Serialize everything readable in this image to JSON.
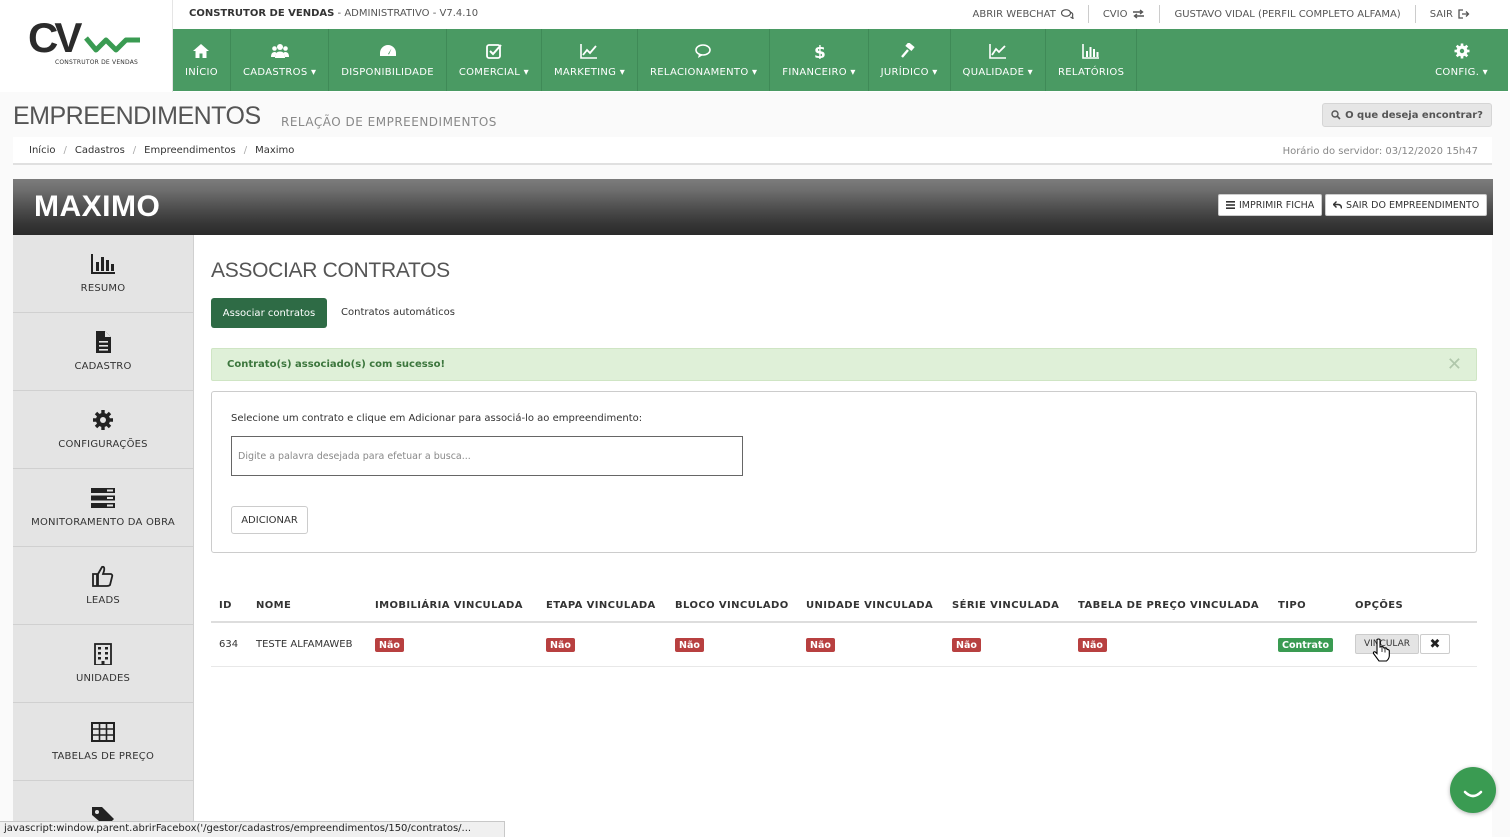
{
  "brand": {
    "logo_text": "CV",
    "tagline": "CONSTRUTOR DE VENDAS"
  },
  "system": {
    "name": "CONSTRUTOR DE VENDAS",
    "rest": " - ADMINISTRATIVO - V7.4.10"
  },
  "toplinks": [
    "ABRIR WEBCHAT",
    "CVIO",
    "GUSTAVO VIDAL (PERFIL COMPLETO ALFAMA)",
    "SAIR"
  ],
  "nav": [
    {
      "label": "INÍCIO",
      "icon": "home-icon"
    },
    {
      "label": "CADASTROS ▾",
      "icon": "users-icon"
    },
    {
      "label": "DISPONIBILIDADE",
      "icon": "dashboard-icon"
    },
    {
      "label": "COMERCIAL ▾",
      "icon": "check-square-icon"
    },
    {
      "label": "MARKETING ▾",
      "icon": "line-chart-icon"
    },
    {
      "label": "RELACIONAMENTO ▾",
      "icon": "chat-bubbles-icon"
    },
    {
      "label": "FINANCEIRO ▾",
      "icon": "dollar-icon"
    },
    {
      "label": "JURÍDICO ▾",
      "icon": "gavel-icon"
    },
    {
      "label": "QUALIDADE ▾",
      "icon": "area-chart-icon"
    },
    {
      "label": "RELATÓRIOS",
      "icon": "bar-chart-icon"
    }
  ],
  "config_label": "CONFIG. ▾",
  "page": {
    "title": "EMPREENDIMENTOS",
    "subtitle": "RELAÇÃO DE EMPREENDIMENTOS",
    "search_label": "O que deseja encontrar?"
  },
  "breadcrumb": [
    "Início",
    "Cadastros",
    "Empreendimentos",
    "Maximo"
  ],
  "server_time": "Horário do servidor: 03/12/2020 15h47",
  "banner": {
    "name": "MAXIMO",
    "print_label": "IMPRIMIR FICHA",
    "exit_label": "SAIR DO EMPREENDIMENTO"
  },
  "sidebar": [
    {
      "label": "RESUMO",
      "icon": "bar-chart-icon"
    },
    {
      "label": "CADASTRO",
      "icon": "file-icon"
    },
    {
      "label": "CONFIGURAÇÕES",
      "icon": "gear-icon"
    },
    {
      "label": "MONITORAMENTO DA OBRA",
      "icon": "server-icon"
    },
    {
      "label": "LEADS",
      "icon": "thumbs-up-icon"
    },
    {
      "label": "UNIDADES",
      "icon": "building-icon"
    },
    {
      "label": "TABELAS DE PREÇO",
      "icon": "table-icon"
    },
    {
      "label": "",
      "icon": "tags-icon"
    }
  ],
  "section": {
    "title": "ASSOCIAR CONTRATOS",
    "tab_active": "Associar contratos",
    "tab_other": "Contratos automáticos",
    "alert": "Contrato(s) associado(s) com sucesso!",
    "instruction": "Selecione um contrato e clique em Adicionar para associá-lo ao empreendimento:",
    "search_placeholder": "Digite a palavra desejada para efetuar a busca...",
    "add_label": "ADICIONAR"
  },
  "table": {
    "headers": [
      "ID",
      "NOME",
      "IMOBILIÁRIA VINCULADA",
      "ETAPA VINCULADA",
      "BLOCO VINCULADO",
      "UNIDADE VINCULADA",
      "SÉRIE VINCULADA",
      "TABELA DE PREÇO VINCULADA",
      "TIPO",
      "OPÇÕES"
    ],
    "rows": [
      {
        "id": "634",
        "nome": "TESTE ALFAMAWEB",
        "imobiliaria": "Não",
        "etapa": "Não",
        "bloco": "Não",
        "unidade": "Não",
        "serie": "Não",
        "tabela": "Não",
        "tipo": "Contrato",
        "vincular_label": "VINCULAR",
        "remove_label": "✖"
      }
    ]
  },
  "statusbar": "javascript:window.parent.abrirFacebox('/gestor/cadastros/empreendimentos/150/contratos/...",
  "colors": {
    "nav": "#4a9a63",
    "primary_dark": "#2e6b45",
    "danger": "#b84040",
    "success": "#3a9b52"
  }
}
